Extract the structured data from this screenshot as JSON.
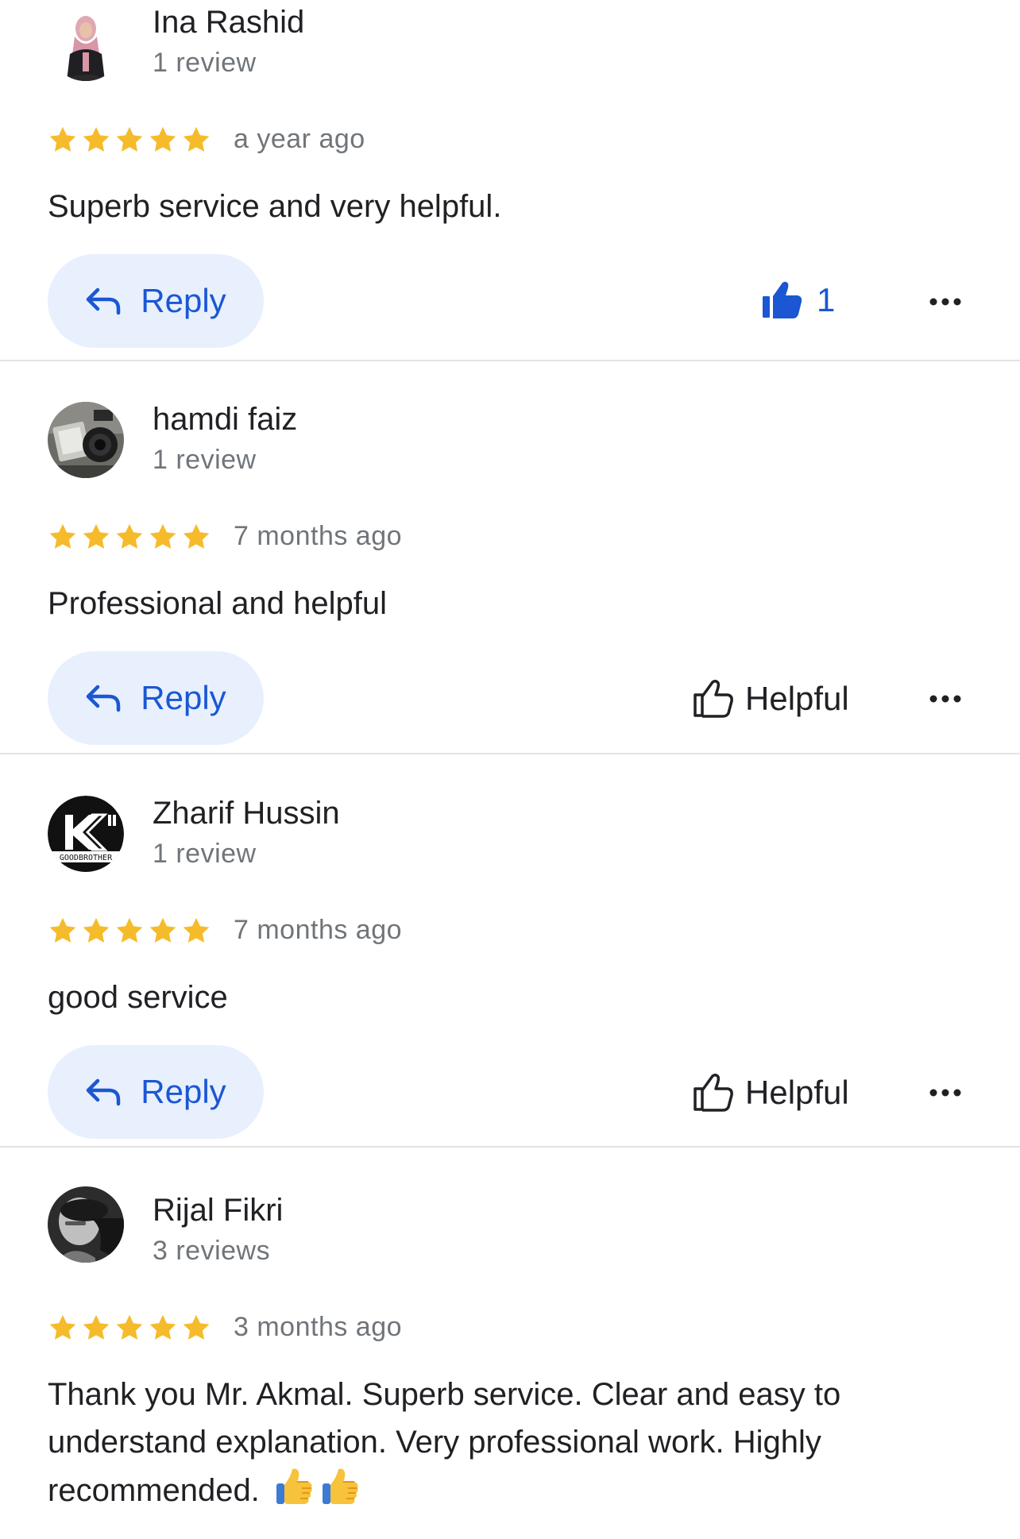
{
  "reviews": [
    {
      "author": "Ina Rashid",
      "count": "1 review",
      "rating": 5,
      "time": "a year ago",
      "text": "Superb service and very helpful.",
      "reply_label": "Reply",
      "helpful_label": "Helpful",
      "likes": "1",
      "liked": true,
      "avatar_icon": "person-photo-icon"
    },
    {
      "author": "hamdi faiz",
      "count": "1 review",
      "rating": 5,
      "time": "7 months ago",
      "text": "Professional and helpful",
      "reply_label": "Reply",
      "helpful_label": "Helpful",
      "liked": false,
      "avatar_icon": "camera-photo-icon"
    },
    {
      "author": "Zharif Hussin",
      "count": "1 review",
      "rating": 5,
      "time": "7 months ago",
      "text": "good service",
      "reply_label": "Reply",
      "helpful_label": "Helpful",
      "liked": false,
      "avatar_icon": "logo-k-icon",
      "avatar_text": "GOODBROTHER"
    },
    {
      "author": "Rijal Fikri",
      "count": "3 reviews",
      "rating": 5,
      "time": "3 months ago",
      "text": "Thank you Mr. Akmal. Superb service. Clear and easy to understand explanation. Very professional work. Highly recommended.",
      "emoji": [
        "thumbs-up-emoji",
        "thumbs-up-emoji"
      ],
      "avatar_icon": "person-photo-icon"
    }
  ],
  "colors": {
    "star": "#f6bb2b",
    "accent": "#1b57d3",
    "reply_bg": "#e8f0fe",
    "muted": "#70757a",
    "text": "#202124"
  }
}
